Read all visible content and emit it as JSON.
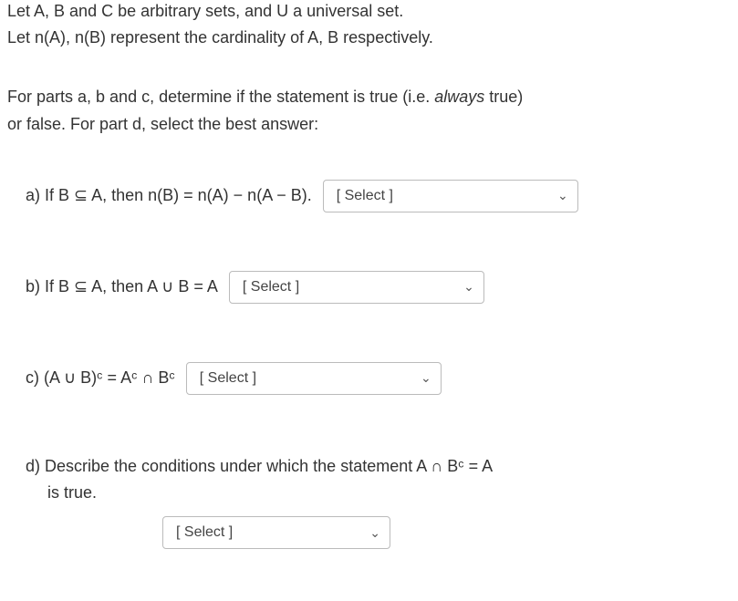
{
  "intro": {
    "line1": "Let A, B and C be arbitrary sets, and U a universal set.",
    "line2": "Let n(A), n(B) represent the cardinality of A, B respectively."
  },
  "instructions": {
    "line1_pre": "For parts a, b and c, determine if the statement is true (i.e. ",
    "line1_italic": "always",
    "line1_post": " true)",
    "line2": "or false.  For part d, select the best answer:"
  },
  "questions": {
    "a": "a)  If B ⊆ A, then  n(B) = n(A) − n(A − B).",
    "b": "b)  If B ⊆ A, then A ∪ B = A",
    "c": "c)  (A ∪ B)ᶜ = Aᶜ ∩ Bᶜ",
    "d_line1": "d)  Describe the conditions under which the statement A ∩ Bᶜ = A",
    "d_line2": "is true."
  },
  "select": {
    "placeholder": "[ Select ]"
  }
}
